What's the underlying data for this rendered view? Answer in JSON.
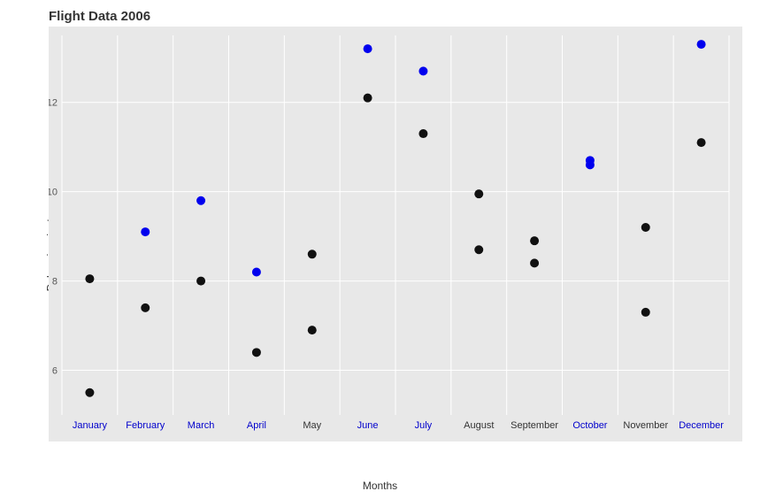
{
  "title": "Flight Data 2006",
  "yAxisLabel": "Delays in minutes",
  "xAxisLabel": "Months",
  "yMin": 5,
  "yMax": 13.5,
  "months": [
    {
      "label": "January",
      "x": 0,
      "blue": true
    },
    {
      "label": "February",
      "x": 1,
      "blue": true
    },
    {
      "label": "March",
      "x": 2,
      "blue": true
    },
    {
      "label": "April",
      "x": 3,
      "blue": true
    },
    {
      "label": "May",
      "x": 4,
      "blue": false
    },
    {
      "label": "June",
      "x": 5,
      "blue": true
    },
    {
      "label": "July",
      "x": 6,
      "blue": true
    },
    {
      "label": "August",
      "x": 7,
      "blue": false
    },
    {
      "label": "September",
      "x": 8,
      "blue": false
    },
    {
      "label": "October",
      "x": 9,
      "blue": true
    },
    {
      "label": "November",
      "x": 10,
      "blue": false
    },
    {
      "label": "December",
      "x": 11,
      "blue": true
    }
  ],
  "points": [
    {
      "month": 0,
      "value": 8.05,
      "blue": false
    },
    {
      "month": 0,
      "value": 5.5,
      "blue": false
    },
    {
      "month": 1,
      "value": 9.1,
      "blue": true
    },
    {
      "month": 1,
      "value": 7.4,
      "blue": false
    },
    {
      "month": 2,
      "value": 9.8,
      "blue": true
    },
    {
      "month": 2,
      "value": 8.0,
      "blue": false
    },
    {
      "month": 3,
      "value": 8.2,
      "blue": true
    },
    {
      "month": 3,
      "value": 6.4,
      "blue": false
    },
    {
      "month": 4,
      "value": 8.6,
      "blue": false
    },
    {
      "month": 4,
      "value": 6.9,
      "blue": false
    },
    {
      "month": 5,
      "value": 13.2,
      "blue": true
    },
    {
      "month": 5,
      "value": 12.1,
      "blue": false
    },
    {
      "month": 6,
      "value": 12.7,
      "blue": true
    },
    {
      "month": 6,
      "value": 11.3,
      "blue": false
    },
    {
      "month": 7,
      "value": 9.95,
      "blue": false
    },
    {
      "month": 7,
      "value": 8.7,
      "blue": false
    },
    {
      "month": 8,
      "value": 8.9,
      "blue": false
    },
    {
      "month": 8,
      "value": 8.4,
      "blue": false
    },
    {
      "month": 9,
      "value": 10.7,
      "blue": true
    },
    {
      "month": 9,
      "value": 10.6,
      "blue": true
    },
    {
      "month": 10,
      "value": 9.2,
      "blue": false
    },
    {
      "month": 10,
      "value": 7.3,
      "blue": false
    },
    {
      "month": 11,
      "value": 13.3,
      "blue": true
    },
    {
      "month": 11,
      "value": 11.1,
      "blue": false
    }
  ],
  "yTicks": [
    6,
    8,
    10,
    12
  ],
  "gridColor": "#ffffff",
  "plotBg": "#e8e8e8"
}
